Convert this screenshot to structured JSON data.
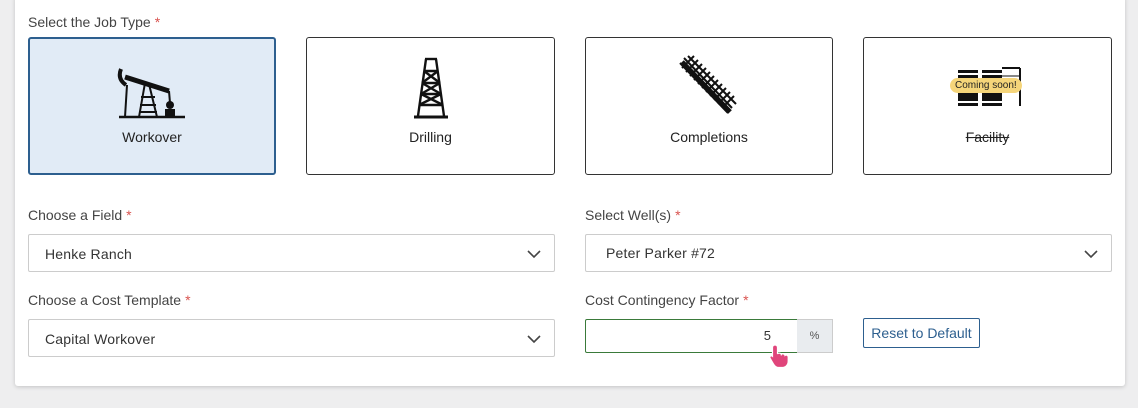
{
  "job_type": {
    "label": "Select the Job Type",
    "required_mark": "*",
    "options": [
      {
        "name": "Workover",
        "icon": "pumpjack-icon",
        "selected": true,
        "disabled": false
      },
      {
        "name": "Drilling",
        "icon": "derrick-icon",
        "selected": false,
        "disabled": false
      },
      {
        "name": "Completions",
        "icon": "perforation-icon",
        "selected": false,
        "disabled": false
      },
      {
        "name": "Facility",
        "icon": "facility-icon",
        "selected": false,
        "disabled": true,
        "badge": "Coming soon!"
      }
    ]
  },
  "field": {
    "label": "Choose a Field",
    "required_mark": "*",
    "value": "Henke Ranch"
  },
  "wells": {
    "label": "Select Well(s)",
    "required_mark": "*",
    "value": "Peter Parker #72"
  },
  "cost_template": {
    "label": "Choose a Cost Template",
    "required_mark": "*",
    "value": "Capital Workover"
  },
  "contingency": {
    "label": "Cost Contingency Factor",
    "required_mark": "*",
    "value": "5",
    "unit": "%",
    "reset_label": "Reset to Default"
  },
  "colors": {
    "selected_bg": "#e1ebf6",
    "selected_border": "#2d5f8f",
    "required": "#d9534f",
    "active_input_border": "#3a7a3a",
    "badge_bg": "#f5d57a"
  }
}
